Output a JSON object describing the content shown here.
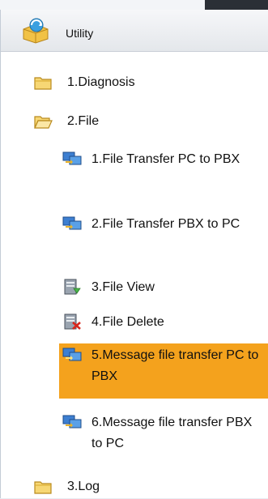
{
  "header": {
    "title": "Utility"
  },
  "tree": {
    "diagnosis": {
      "label": "1.Diagnosis"
    },
    "file": {
      "label": "2.File"
    },
    "file_items": [
      {
        "label": "1.File Transfer PC to PBX"
      },
      {
        "label": "2.File Transfer PBX to PC"
      },
      {
        "label": "3.File View"
      },
      {
        "label": "4.File Delete"
      },
      {
        "label": "5.Message file transfer PC to PBX"
      },
      {
        "label": "6.Message file transfer PBX to PC"
      }
    ],
    "log": {
      "label": "3.Log"
    }
  },
  "selected_item": "5.Message file transfer PC to PBX",
  "colors": {
    "selection": "#f4a21d",
    "folder": "#e9b93b"
  },
  "icons": {
    "header": "utility-box-icon",
    "folder_closed": "folder-icon",
    "folder_open": "open-folder-icon",
    "transfer": "file-transfer-icon",
    "view": "file-view-icon",
    "delete": "file-delete-icon"
  }
}
